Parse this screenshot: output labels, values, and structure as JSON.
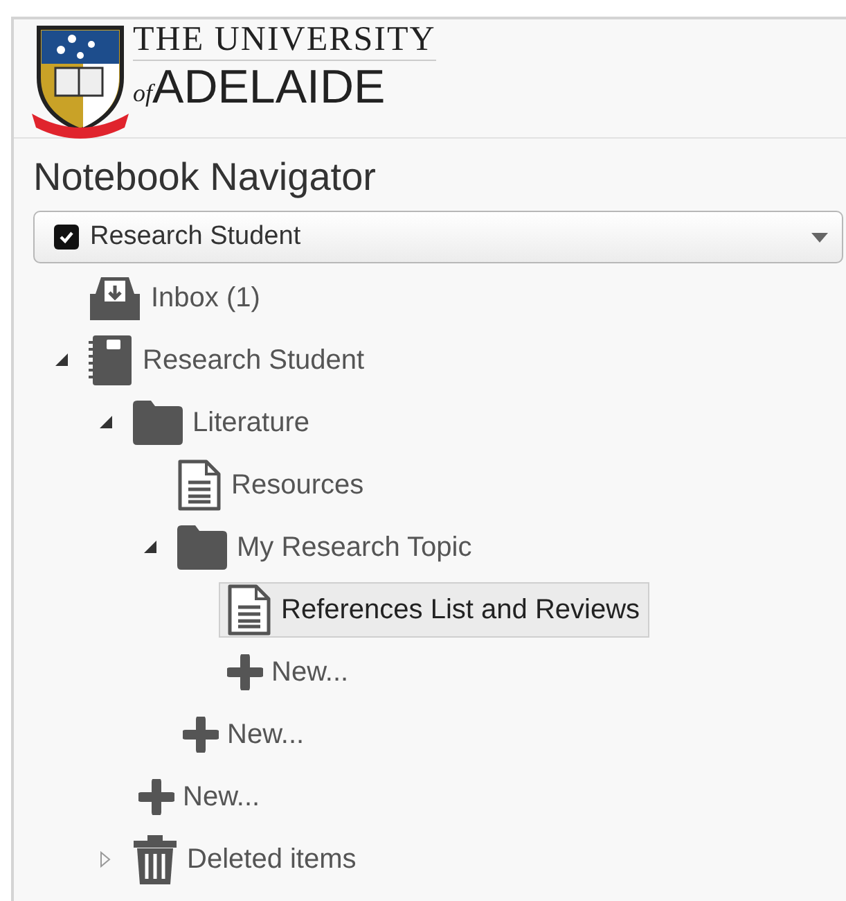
{
  "logo": {
    "line_1": "THE UNIVERSITY",
    "prefix": "of",
    "line_2": "ADELAIDE"
  },
  "title": "Notebook Navigator",
  "notebook_select": {
    "value": "Research Student",
    "checked": true
  },
  "tree": [
    {
      "kind": "inbox",
      "label": "Inbox (1)",
      "selected": false
    },
    {
      "kind": "notebook",
      "label": "Research Student",
      "selected": false,
      "expanded": true,
      "children": [
        {
          "kind": "folder",
          "label": "Literature",
          "selected": false,
          "expanded": true,
          "children": [
            {
              "kind": "page",
              "label": "Resources",
              "selected": false
            },
            {
              "kind": "folder",
              "label": "My Research Topic",
              "selected": false,
              "expanded": true,
              "children": [
                {
                  "kind": "page",
                  "label": "References List and Reviews",
                  "selected": true
                },
                {
                  "kind": "new",
                  "label": "New...",
                  "selected": false
                }
              ]
            },
            {
              "kind": "new",
              "label": "New...",
              "selected": false
            }
          ]
        },
        {
          "kind": "new",
          "label": "New...",
          "selected": false
        },
        {
          "kind": "trash",
          "label": "Deleted items",
          "selected": false,
          "expanded": false
        }
      ]
    }
  ]
}
